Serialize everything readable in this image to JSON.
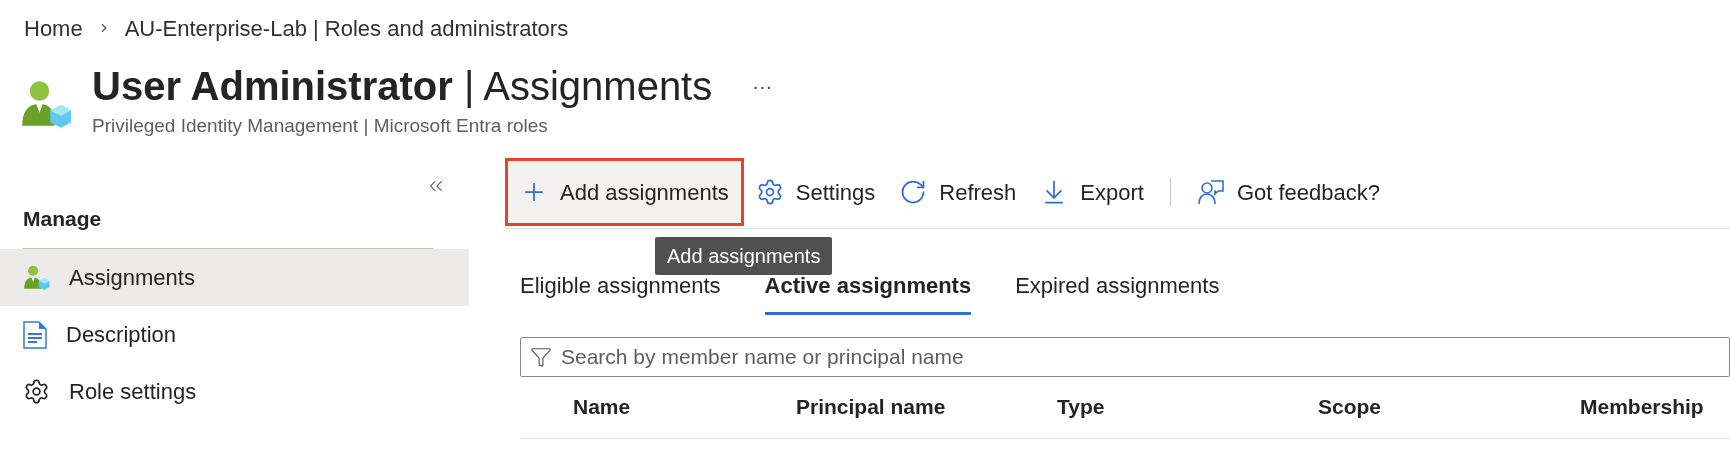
{
  "breadcrumb": [
    {
      "label": "Home"
    },
    {
      "label": "AU-Enterprise-Lab | Roles and administrators"
    }
  ],
  "header": {
    "title": "User Administrator",
    "separator": "|",
    "subtitle_part": "Assignments",
    "more": "···",
    "description": "Privileged Identity Management | Microsoft Entra roles"
  },
  "sidebar": {
    "section": "Manage",
    "items": [
      {
        "label": "Assignments",
        "kind": "persona",
        "selected": true
      },
      {
        "label": "Description",
        "kind": "document",
        "selected": false
      },
      {
        "label": "Role settings",
        "kind": "gear",
        "selected": false
      }
    ]
  },
  "toolbar": [
    {
      "label": "Add assignments",
      "kind": "add",
      "highlighted": true
    },
    {
      "label": "Settings",
      "kind": "settings",
      "highlighted": false
    },
    {
      "label": "Refresh",
      "kind": "refresh",
      "highlighted": false
    },
    {
      "label": "Export",
      "kind": "export",
      "highlighted": false
    },
    {
      "label": "Got feedback?",
      "kind": "feedback",
      "highlighted": false
    }
  ],
  "tooltip": "Add assignments",
  "tabs": [
    {
      "label": "Eligible assignments",
      "selected": false
    },
    {
      "label": "Active assignments",
      "selected": true
    },
    {
      "label": "Expired assignments",
      "selected": false
    }
  ],
  "search": {
    "placeholder": "Search by member name or principal name"
  },
  "table": {
    "columns": [
      "Name",
      "Principal name",
      "Type",
      "Scope",
      "Membership"
    ]
  }
}
